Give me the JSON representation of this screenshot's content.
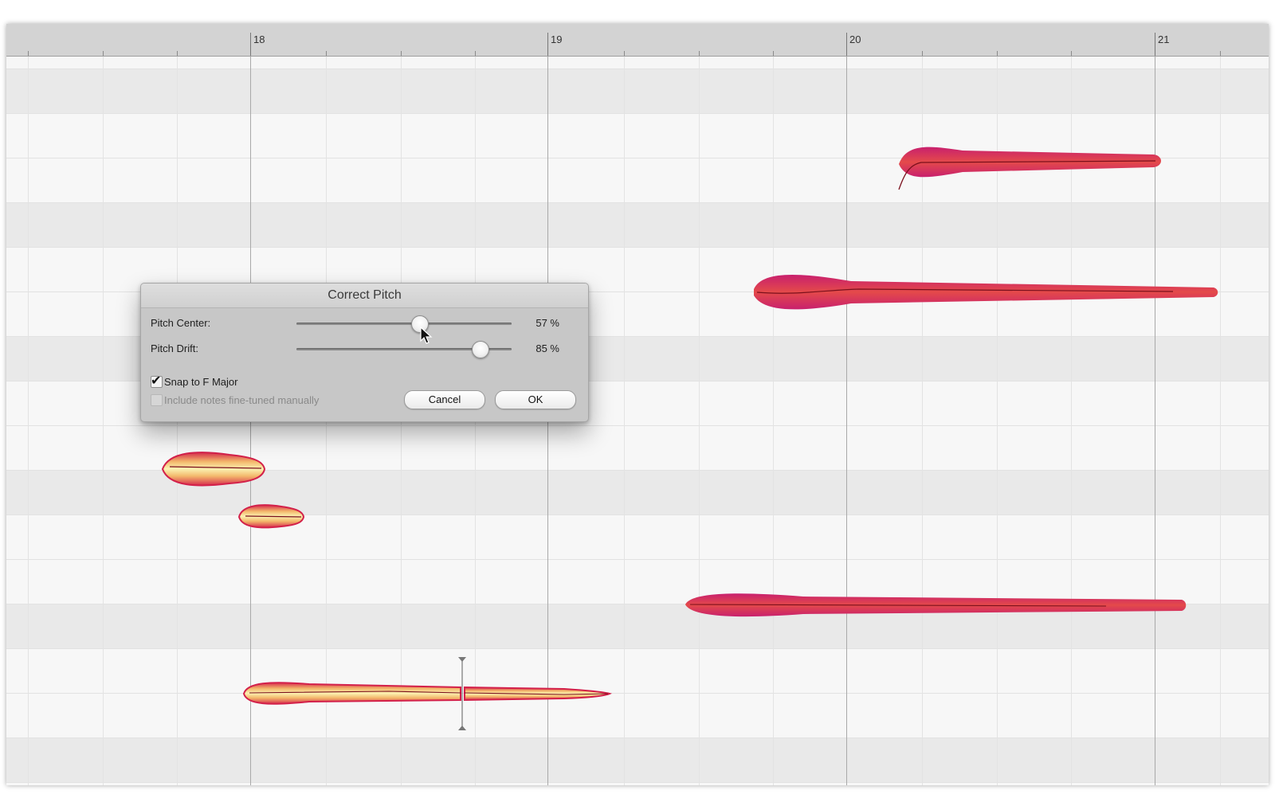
{
  "ruler": {
    "bars": [
      "18",
      "19",
      "20",
      "21"
    ]
  },
  "dialog": {
    "title": "Correct Pitch",
    "pitch_center": {
      "label": "Pitch Center:",
      "value_text": "57 %",
      "value": 0.57
    },
    "pitch_drift": {
      "label": "Pitch Drift:",
      "value_text": "85 %",
      "value": 0.85
    },
    "snap_to_key": {
      "label": "Snap to F Major",
      "checked": true
    },
    "include_fine_tuned": {
      "label": "Include notes fine-tuned manually",
      "checked": false,
      "enabled": false
    },
    "cancel_label": "Cancel",
    "ok_label": "OK"
  },
  "colors": {
    "selected_note_fill": "#f0df96",
    "selected_note_edge": "#d3204a",
    "note_fill": "#d4286a",
    "note_edge": "#e8503a",
    "pitch_curve": "#7a0f1c"
  }
}
